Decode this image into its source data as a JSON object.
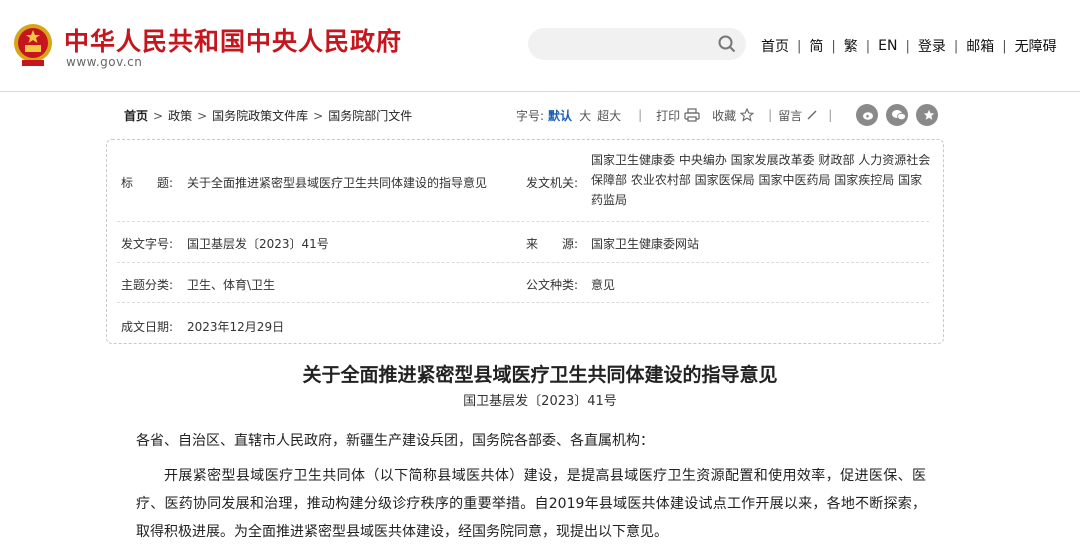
{
  "header": {
    "site_name": "中华人民共和国中央人民政府",
    "site_url": "www.gov.cn",
    "search_placeholder": "",
    "nav": [
      "首页",
      "简",
      "繁",
      "EN",
      "登录",
      "邮箱",
      "无障碍"
    ]
  },
  "breadcrumb": [
    "首页",
    "政策",
    "国务院政策文件库",
    "国务院部门文件"
  ],
  "tools": {
    "font_label": "字号:",
    "font_default": "默认",
    "font_large": "大",
    "font_xlarge": "超大",
    "print": "打印",
    "favorite": "收藏",
    "comment": "留言"
  },
  "info": {
    "title_label": "标　　题:",
    "title_value": "关于全面推进紧密型县域医疗卫生共同体建设的指导意见",
    "issuer_label": "发文机关:",
    "issuer_value": "国家卫生健康委 中央编办 国家发展改革委 财政部 人力资源社会保障部 农业农村部 国家医保局 国家中医药局 国家疾控局 国家药监局",
    "docno_label": "发文字号:",
    "docno_value": "国卫基层发〔2023〕41号",
    "source_label": "来　　源:",
    "source_value": "国家卫生健康委网站",
    "category_label": "主题分类:",
    "category_value": "卫生、体育\\卫生",
    "type_label": "公文种类:",
    "type_value": "意见",
    "date_label": "成文日期:",
    "date_value": "2023年12月29日"
  },
  "article": {
    "title": "关于全面推进紧密型县域医疗卫生共同体建设的指导意见",
    "doc_no": "国卫基层发〔2023〕41号",
    "salutation": "各省、自治区、直辖市人民政府，新疆生产建设兵团，国务院各部委、各直属机构：",
    "paragraph": "开展紧密型县域医疗卫生共同体（以下简称县域医共体）建设，是提高县域医疗卫生资源配置和使用效率，促进医保、医疗、医药协同发展和治理，推动构建分级诊疗秩序的重要举措。自2019年县域医共体建设试点工作开展以来，各地不断探索，取得积极进展。为全面推进紧密型县域医共体建设，经国务院同意，现提出以下意见。"
  },
  "colors": {
    "brand_red": "#c4161c",
    "accent_blue": "#1a5fb4"
  }
}
